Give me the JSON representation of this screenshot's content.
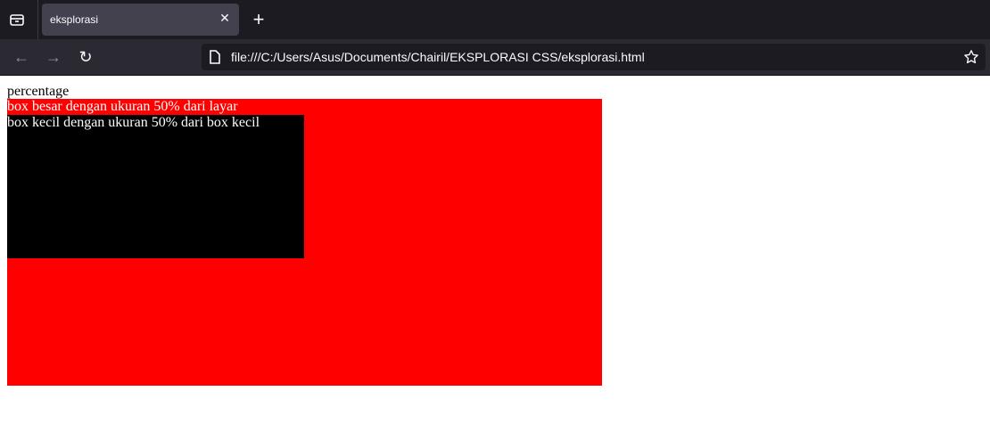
{
  "browser": {
    "tab_title": "eksplorasi",
    "url": "file:///C:/Users/Asus/Documents/Chairil/EKSPLORASI CSS/eksplorasi.html",
    "icons": [
      "tabs-list-icon",
      "close-icon",
      "plus-icon",
      "back-arrow-icon",
      "forward-arrow-icon",
      "reload-icon",
      "file-icon",
      "star-icon"
    ]
  },
  "page": {
    "heading": "percentage",
    "big_box_text": "box besar dengan ukuran 50% dari layar",
    "small_box_text": "box kecil dengan ukuran 50% dari box kecil",
    "colors": {
      "big_box": "#ff0000",
      "small_box": "#000000"
    }
  }
}
